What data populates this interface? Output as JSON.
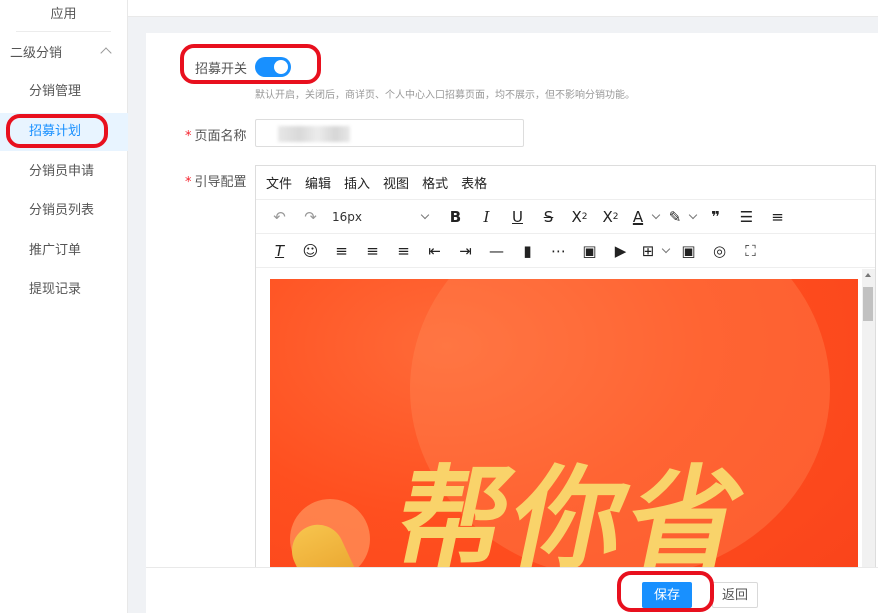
{
  "sidebar": {
    "top_label": "应用",
    "group_label": "二级分销",
    "items": [
      {
        "label": "分销管理"
      },
      {
        "label": "招募计划"
      },
      {
        "label": "分销员申请"
      },
      {
        "label": "分销员列表"
      },
      {
        "label": "推广订单"
      },
      {
        "label": "提现记录"
      }
    ]
  },
  "form": {
    "switch_label": "招募开关",
    "switch_on": true,
    "switch_hint": "默认开启，关闭后，商详页、个人中心入口招募页面，均不展示，但不影响分销功能。",
    "name_label": "页面名称",
    "guide_label": "引导配置",
    "required_mark": "*"
  },
  "editor": {
    "menus": [
      "文件",
      "编辑",
      "插入",
      "视图",
      "格式",
      "表格"
    ],
    "font_size": "16px",
    "banner_text": "帮你省"
  },
  "footer": {
    "save_label": "保存",
    "back_label": "返回"
  },
  "colors": {
    "primary": "#1890ff",
    "highlight_oval": "#e8101e",
    "banner": "#ff4f1f"
  }
}
